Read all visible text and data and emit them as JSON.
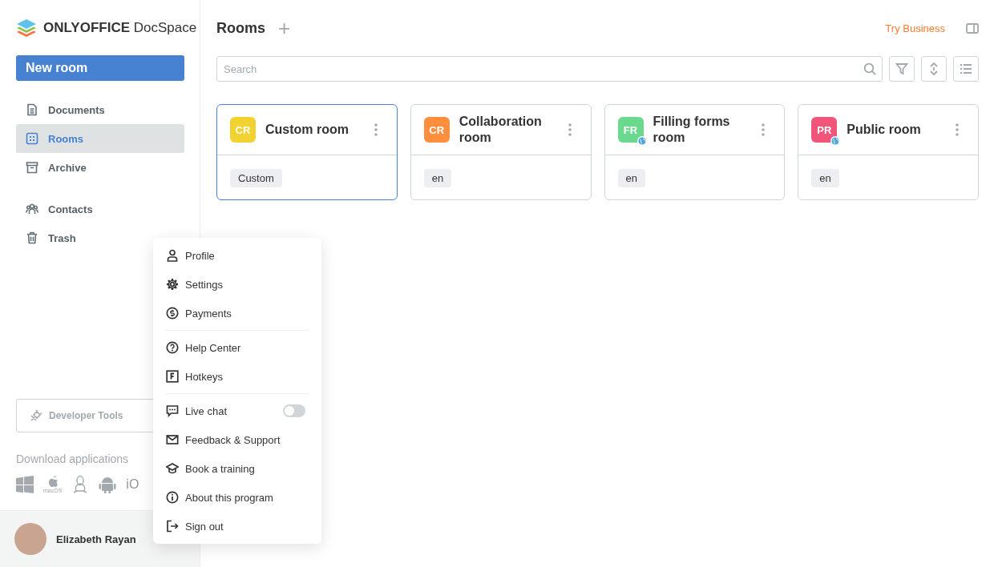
{
  "sidebar": {
    "logo": {
      "brand": "ONLYOFFICE",
      "product": "DocSpace"
    },
    "new_room_button": "New room",
    "nav_groups": [
      [
        {
          "label": "Documents",
          "selected": false
        },
        {
          "label": "Rooms",
          "selected": true
        },
        {
          "label": "Archive",
          "selected": false
        }
      ],
      [
        {
          "label": "Contacts",
          "selected": false
        },
        {
          "label": "Trash",
          "selected": false
        }
      ]
    ],
    "developer_tools": "Developer Tools",
    "download_title": "Download applications",
    "download_partial_label": "iO",
    "macos_label": "macOS",
    "user": {
      "name": "Elizabeth Rayan"
    }
  },
  "header": {
    "title": "Rooms",
    "add_symbol": "+",
    "try_business": "Try Business"
  },
  "search": {
    "placeholder": "Search"
  },
  "rooms": [
    {
      "initials": "CR",
      "title": "Custom room",
      "color": "#f2d230",
      "public": false,
      "tag": "Custom",
      "selected": true
    },
    {
      "initials": "CR",
      "title": "Collaboration room",
      "color": "#ff8e3d",
      "public": false,
      "tag": "en",
      "selected": false
    },
    {
      "initials": "FR",
      "title": "Filling forms room",
      "color": "#6bd98d",
      "public": true,
      "tag": "en",
      "selected": false
    },
    {
      "initials": "PR",
      "title": "Public room",
      "color": "#f2557a",
      "public": true,
      "tag": "en",
      "selected": false
    }
  ],
  "profile_menu": {
    "sections": [
      [
        {
          "kind": "item",
          "label": "Profile"
        },
        {
          "kind": "item",
          "label": "Settings"
        },
        {
          "kind": "item",
          "label": "Payments"
        }
      ],
      [
        {
          "kind": "item",
          "label": "Help Center"
        },
        {
          "kind": "item",
          "label": "Hotkeys"
        }
      ],
      [
        {
          "kind": "toggle",
          "label": "Live chat",
          "on": false
        },
        {
          "kind": "item",
          "label": "Feedback & Support"
        },
        {
          "kind": "item",
          "label": "Book a training"
        },
        {
          "kind": "item",
          "label": "About this program"
        },
        {
          "kind": "item",
          "label": "Sign out"
        }
      ]
    ]
  }
}
